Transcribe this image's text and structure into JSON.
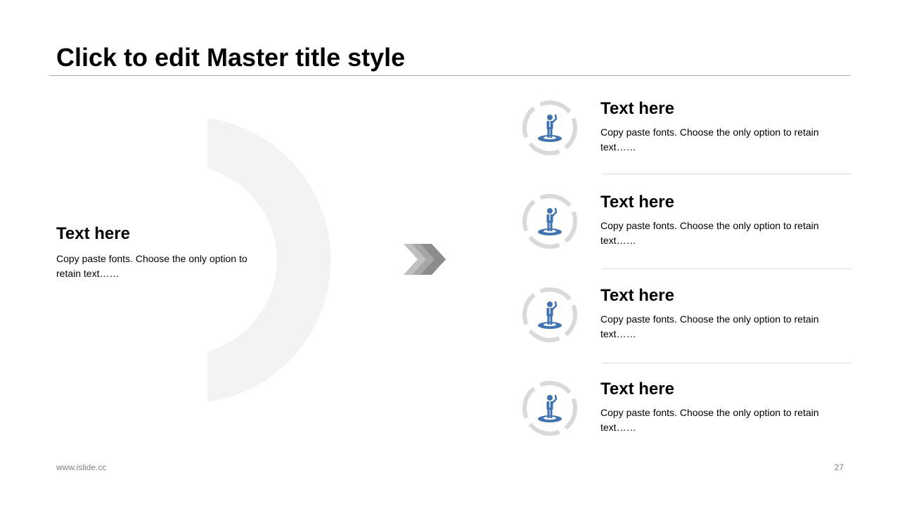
{
  "slide": {
    "title": "Click to edit Master title style"
  },
  "left": {
    "heading": "Text here",
    "body": "Copy paste fonts. Choose the only option to retain text……"
  },
  "items": [
    {
      "heading": "Text here",
      "body": "Copy paste fonts. Choose the only option to retain text……",
      "icon": "person-icon"
    },
    {
      "heading": "Text here",
      "body": "Copy paste fonts. Choose the only option to retain text……",
      "icon": "person-icon"
    },
    {
      "heading": "Text here",
      "body": "Copy paste fonts. Choose the only option to retain text……",
      "icon": "person-icon"
    },
    {
      "heading": "Text here",
      "body": "Copy paste fonts. Choose the only option to retain text……",
      "icon": "person-icon"
    }
  ],
  "footer": {
    "url": "www.islide.cc",
    "page_number": "27"
  },
  "colors": {
    "accent": "#3f72af",
    "ring": "#d9d9d9",
    "chevron": "#a6a6a6",
    "arc": "#f2f2f2"
  }
}
